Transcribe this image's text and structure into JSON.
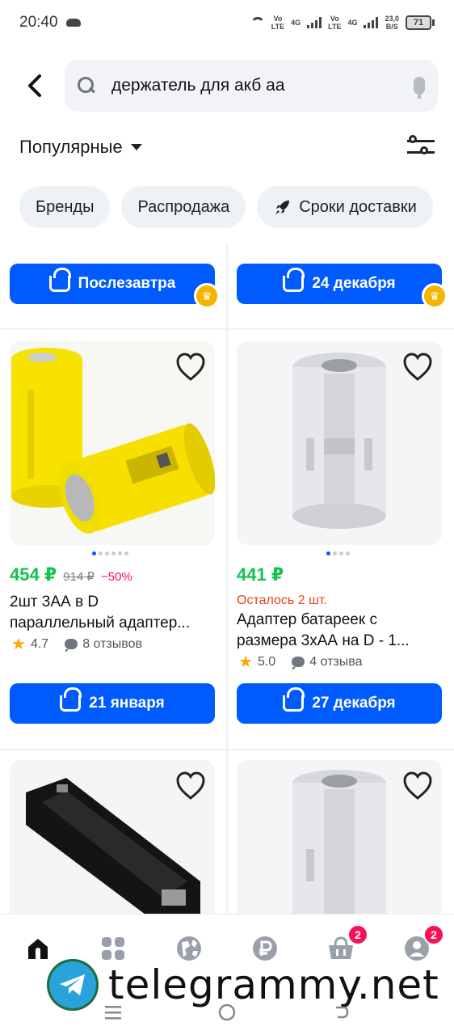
{
  "status": {
    "time": "20:40",
    "net1_top": "Vo",
    "net1_bottom": "LTE",
    "net1_type": "4G",
    "net2_top": "Vo",
    "net2_bottom": "LTE",
    "net2_type": "4G",
    "speed_top": "23,0",
    "speed_bottom": "B/S",
    "battery": "71"
  },
  "search": {
    "query": "держатель для акб аа"
  },
  "sort": {
    "label": "Популярные"
  },
  "chips": [
    {
      "label": "Бренды"
    },
    {
      "label": "Распродажа"
    },
    {
      "label": "Сроки доставки",
      "icon": "rocket-icon"
    }
  ],
  "top_row": {
    "left_delivery": "Послезавтра",
    "right_delivery": "24 декабря"
  },
  "products": [
    {
      "price": "454 ₽",
      "old_price": "914 ₽",
      "discount": "−50%",
      "title_line1": "2шт 3АА в D",
      "title_line2": "параллельный адаптер...",
      "rating": "4.7",
      "reviews": "8 отзывов",
      "delivery": "21 января",
      "image_dots": 6,
      "active_dot": 0
    },
    {
      "price": "441 ₽",
      "stock": "Осталось 2 шт.",
      "title_line1": "Адаптер батареек с",
      "title_line2": "размера 3хАА на D - 1...",
      "rating": "5.0",
      "reviews": "4 отзыва",
      "delivery": "27 декабря",
      "image_dots": 4,
      "active_dot": 0
    }
  ],
  "nav": {
    "basket_badge": "2",
    "profile_badge": "2"
  },
  "watermark": "telegrammy.net",
  "colors": {
    "accent": "#005bff",
    "price": "#10c44c",
    "discount": "#f91155",
    "stock": "#e5461a",
    "badge": "#f91155",
    "crown": "#f5b400"
  }
}
